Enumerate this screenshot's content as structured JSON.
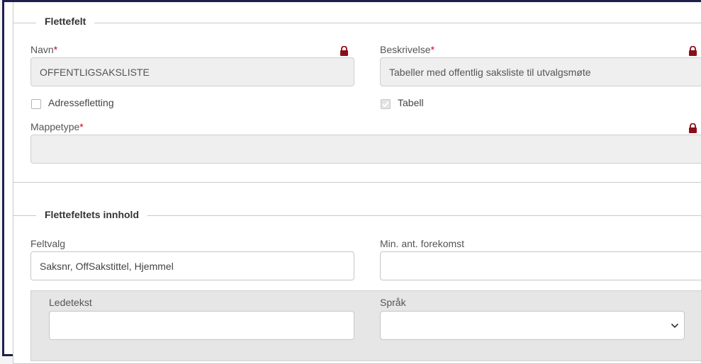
{
  "section1": {
    "legend": "Flettefelt",
    "navn_label": "Navn",
    "navn_value": "OFFENTLIGSAKSLISTE",
    "beskrivelse_label": "Beskrivelse",
    "beskrivelse_value": "Tabeller med offentlig saksliste til utvalgsmøte",
    "adressefletting_label": "Adressefletting",
    "adressefletting_checked": false,
    "tabell_label": "Tabell",
    "tabell_checked": true,
    "mappetype_label": "Mappetype",
    "mappetype_value": "",
    "required_marker": "*"
  },
  "section2": {
    "legend": "Flettefeltets innhold",
    "feltvalg_label": "Feltvalg",
    "feltvalg_value": "Saksnr, OffSakstittel, Hjemmel",
    "min_ant_label": "Min. ant. forekomst",
    "min_ant_value": "",
    "ledetekst_label": "Ledetekst",
    "ledetekst_value": "",
    "sprak_label": "Språk",
    "sprak_value": ""
  },
  "colors": {
    "lock": "#8b0d1a",
    "required": "#d0021b",
    "frame": "#1f1f4d"
  },
  "icons": [
    "lock-icon",
    "chevron-down-icon",
    "checkmark-icon"
  ]
}
